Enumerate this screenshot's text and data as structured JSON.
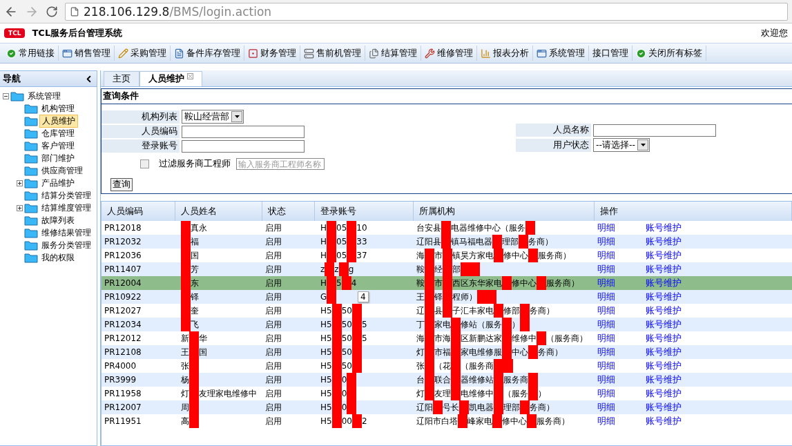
{
  "browser": {
    "address_host": "218.106.129.8",
    "address_path": "/BMS/login.action"
  },
  "header": {
    "logo": "TCL",
    "title": "TCL服务后台管理系统",
    "welcome": "欢迎您"
  },
  "menu": [
    "常用链接",
    "销售管理",
    "采购管理",
    "备件库存管理",
    "财务管理",
    "售前机管理",
    "结算管理",
    "维修管理",
    "报表分析",
    "系统管理",
    "接口管理",
    "关闭所有标签"
  ],
  "sidebar": {
    "title": "导航",
    "tree": [
      {
        "label": "系统管理",
        "expanded": true,
        "selected": false,
        "children": [
          {
            "label": "机构管理",
            "selected": false
          },
          {
            "label": "人员维护",
            "selected": true
          },
          {
            "label": "仓库管理",
            "selected": false
          },
          {
            "label": "客户管理",
            "selected": false
          },
          {
            "label": "部门维护",
            "selected": false
          },
          {
            "label": "供应商管理",
            "selected": false
          },
          {
            "label": "产品维护",
            "selected": false,
            "expanded": false
          },
          {
            "label": "结算分类管理",
            "selected": false
          },
          {
            "label": "结算维度管理",
            "selected": false,
            "expanded": false
          },
          {
            "label": "故障列表",
            "selected": false
          },
          {
            "label": "维修结果管理",
            "selected": false
          },
          {
            "label": "服务分类管理",
            "selected": false
          },
          {
            "label": "我的权限",
            "selected": false
          }
        ]
      }
    ]
  },
  "tabs": [
    {
      "label": "主页",
      "selected": false,
      "closable": false
    },
    {
      "label": "人员维护",
      "selected": true,
      "closable": true
    }
  ],
  "query": {
    "title": "查询条件",
    "fields": [
      {
        "kind": "select",
        "label": "机构列表",
        "value": "鞍山经营部"
      },
      {
        "kind": "input",
        "label": "人员编码"
      },
      {
        "kind": "input",
        "label": "登录账号"
      }
    ],
    "right_fields": [
      {
        "kind": "input",
        "label": "人员名称"
      },
      {
        "kind": "select",
        "label": "用户状态",
        "value": "--请选择--"
      }
    ],
    "filter": {
      "label": "过滤服务商工程师",
      "checked": false,
      "placeholder": "输入服务商工程师名称"
    },
    "button": "查询"
  },
  "table": {
    "columns": [
      "人员编码",
      "人员姓名",
      "状态",
      "登录账号",
      "所属机构",
      "操作"
    ],
    "rows": [
      {
        "code": "PR12018",
        "name": [
          {
            "kind": "scribble"
          },
          "真永"
        ],
        "status": "启用",
        "login": [
          "H",
          {
            "kind": "scribble"
          },
          "05",
          {
            "kind": "scribble"
          },
          "10"
        ],
        "org": [
          "台安县",
          {
            "kind": "scribble"
          },
          "电器维修中心（服务",
          {
            "kind": "scribble"
          }
        ],
        "actions": [
          "明细",
          "账号维护"
        ],
        "selected": false
      },
      {
        "code": "PR12032",
        "name": [
          {
            "kind": "scribble"
          },
          "福"
        ],
        "status": "启用",
        "login": [
          "H",
          {
            "kind": "scribble"
          },
          "05",
          {
            "kind": "scribble"
          },
          "33"
        ],
        "org": [
          "辽阳县",
          {
            "kind": "scribble"
          },
          "镇马福电器",
          {
            "kind": "scribble"
          },
          "理部",
          {
            "kind": "scribble"
          },
          "务商）"
        ],
        "actions": [
          "明细",
          "账号维护"
        ],
        "selected": false
      },
      {
        "code": "PR12036",
        "name": [
          {
            "kind": "scribble"
          },
          "国"
        ],
        "status": "启用",
        "login": [
          "H",
          {
            "kind": "scribble"
          },
          "05",
          {
            "kind": "scribble"
          },
          "37"
        ],
        "org": [
          "海",
          {
            "kind": "scribble"
          },
          "市",
          {
            "kind": "scribble"
          },
          "镇昊方家电",
          {
            "kind": "scribble"
          },
          "修中心",
          {
            "kind": "scribble"
          },
          "服务商）"
        ],
        "actions": [
          "明细",
          "账号维护"
        ],
        "selected": false
      },
      {
        "code": "PR11407",
        "name": [
          {
            "kind": "scribble"
          },
          "芳"
        ],
        "status": "启用",
        "login": [
          "z",
          {
            "kind": "scribble"
          },
          "z",
          {
            "kind": "scribble"
          },
          "g"
        ],
        "org": [
          "鞍",
          {
            "kind": "scribble"
          },
          "经",
          {
            "kind": "scribble"
          },
          "部",
          {
            "kind": "scribble"
          },
          {
            "kind": "scribble"
          }
        ],
        "actions": [
          "明细",
          "账号维护"
        ],
        "selected": false
      },
      {
        "code": "PR12004",
        "name": [
          {
            "kind": "scribble"
          },
          "东"
        ],
        "status": "启用",
        "login": [
          "H",
          {
            "kind": "scribble"
          },
          "5",
          {
            "kind": "scribble"
          },
          "4"
        ],
        "org": [
          "鞍",
          {
            "kind": "scribble"
          },
          "市",
          {
            "kind": "scribble"
          },
          "西区东华家电",
          {
            "kind": "scribble"
          },
          "修中心",
          {
            "kind": "scribble"
          },
          "服务商）"
        ],
        "actions": [
          "明细",
          "账号维护"
        ],
        "selected": true
      },
      {
        "code": "PR10922",
        "name": [
          {
            "kind": "scribble"
          },
          "铎"
        ],
        "status": "启用",
        "login": [
          "G",
          {
            "kind": "scribble"
          }
        ],
        "tooltip": "4",
        "org": [
          "王",
          {
            "kind": "scribble"
          },
          "铎",
          {
            "kind": "scribble"
          },
          "程师）",
          {
            "kind": "scribble"
          },
          {
            "kind": "scribble"
          }
        ],
        "actions": [
          "明细",
          "账号维护"
        ],
        "selected": false
      },
      {
        "code": "PR12027",
        "name": [
          {
            "kind": "scribble"
          },
          "奎"
        ],
        "status": "启用",
        "login": [
          "H5",
          {
            "kind": "scribble"
          },
          "50",
          {
            "kind": "scribble"
          }
        ],
        "org": [
          "辽",
          {
            "kind": "scribble"
          },
          "县",
          {
            "kind": "scribble"
          },
          "子汇丰家电",
          {
            "kind": "scribble"
          },
          "修部",
          {
            "kind": "scribble"
          },
          "务商）"
        ],
        "actions": [
          "明细",
          "账号维护"
        ],
        "selected": false
      },
      {
        "code": "PR12034",
        "name": [
          {
            "kind": "scribble"
          },
          "飞"
        ],
        "status": "启用",
        "login": [
          "H5",
          {
            "kind": "scribble"
          },
          "50",
          {
            "kind": "scribble"
          },
          "5"
        ],
        "org": [
          "丁",
          {
            "kind": "scribble"
          },
          "家电",
          {
            "kind": "scribble"
          },
          "修站（服务",
          {
            "kind": "scribble"
          },
          "）",
          {
            "kind": "scribble"
          }
        ],
        "actions": [
          "明细",
          "账号维护"
        ],
        "selected": false
      },
      {
        "code": "PR12012",
        "name": [
          "新",
          {
            "kind": "scribble"
          },
          "华"
        ],
        "status": "启用",
        "login": [
          "H5",
          {
            "kind": "scribble"
          },
          "50",
          {
            "kind": "scribble"
          },
          "5"
        ],
        "org": [
          "海",
          {
            "kind": "scribble"
          },
          "市海",
          {
            "kind": "scribble"
          },
          "区新鹏达家",
          {
            "kind": "scribble"
          },
          "维修中",
          {
            "kind": "scribble"
          },
          "（服务商）"
        ],
        "actions": [
          "明细",
          "账号维护"
        ],
        "selected": false
      },
      {
        "code": "PR12108",
        "name": [
          "王",
          {
            "kind": "scribble"
          },
          "国"
        ],
        "status": "启用",
        "login": [
          "H5",
          {
            "kind": "scribble"
          },
          "50",
          {
            "kind": "scribble"
          }
        ],
        "org": [
          "灯",
          {
            "kind": "scribble"
          },
          "市福",
          {
            "kind": "scribble"
          },
          "家电维修服",
          {
            "kind": "scribble"
          },
          "中心",
          {
            "kind": "scribble"
          },
          "务商）"
        ],
        "actions": [
          "明细",
          "账号维护"
        ],
        "selected": false
      },
      {
        "code": "PR4000",
        "name": [
          "张",
          {
            "kind": "scribble"
          }
        ],
        "status": "启用",
        "login": [
          "H5",
          {
            "kind": "scribble"
          },
          "50",
          {
            "kind": "scribble"
          }
        ],
        "org": [
          "张",
          {
            "kind": "scribble"
          },
          "（花",
          {
            "kind": "scribble"
          },
          "（服务商",
          {
            "kind": "scribble"
          },
          {
            "kind": "scribble"
          }
        ],
        "actions": [
          "明细",
          "账号维护"
        ],
        "selected": false
      },
      {
        "code": "PR3999",
        "name": [
          "杨",
          {
            "kind": "scribble"
          }
        ],
        "status": "启用",
        "login": [
          "H5",
          {
            "kind": "scribble"
          },
          "0",
          {
            "kind": "scribble"
          }
        ],
        "org": [
          "台",
          {
            "kind": "scribble"
          },
          "联合",
          {
            "kind": "scribble"
          },
          "器维修站",
          {
            "kind": "scribble"
          },
          "服务商",
          {
            "kind": "scribble"
          }
        ],
        "actions": [
          "明细",
          "账号维护"
        ],
        "selected": false
      },
      {
        "code": "PR11958",
        "name": [
          "灯",
          {
            "kind": "scribble"
          },
          "友理家电维修中"
        ],
        "status": "启用",
        "login": [
          "H5",
          {
            "kind": "scribble"
          },
          "0",
          {
            "kind": "scribble"
          }
        ],
        "org": [
          "灯",
          {
            "kind": "scribble"
          },
          "友理",
          {
            "kind": "scribble"
          },
          "电维修中",
          {
            "kind": "scribble"
          },
          "（服务",
          {
            "kind": "scribble"
          },
          "）"
        ],
        "actions": [
          "明细",
          "账号维护"
        ],
        "selected": false
      },
      {
        "code": "PR12007",
        "name": [
          "周",
          {
            "kind": "scribble"
          }
        ],
        "status": "启用",
        "login": [
          "H5",
          {
            "kind": "scribble"
          },
          "0",
          {
            "kind": "scribble"
          }
        ],
        "org": [
          "辽阳",
          {
            "kind": "scribble"
          },
          "号长",
          {
            "kind": "scribble"
          },
          "凯电器",
          {
            "kind": "scribble"
          },
          "理部",
          {
            "kind": "scribble"
          },
          "务商）"
        ],
        "actions": [
          "明细",
          "账号维护"
        ],
        "selected": false
      },
      {
        "code": "PR11951",
        "name": [
          "高",
          {
            "kind": "scribble"
          }
        ],
        "status": "启用",
        "login": [
          "H5",
          {
            "kind": "scribble"
          },
          "00",
          {
            "kind": "scribble"
          },
          "2"
        ],
        "org": [
          "辽阳市白塔",
          {
            "kind": "scribble"
          },
          "峰家电",
          {
            "kind": "scribble"
          },
          "修中心",
          {
            "kind": "scribble"
          },
          "服务商）"
        ],
        "actions": [
          "明细",
          "账号维护"
        ],
        "selected": false
      }
    ]
  }
}
